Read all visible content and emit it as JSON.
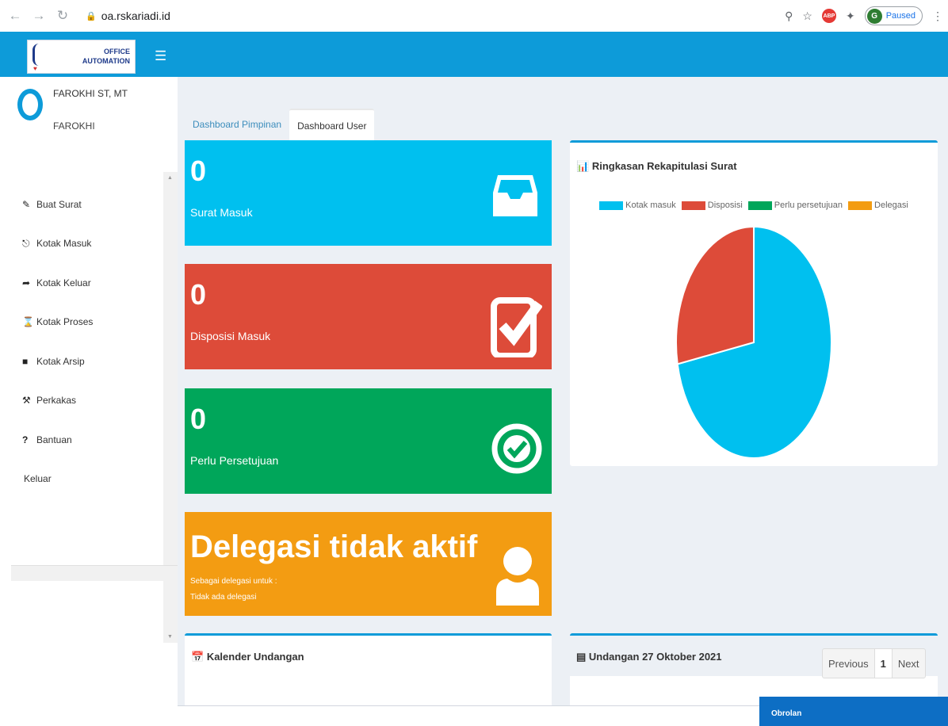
{
  "browser": {
    "url": "oa.rskariadi.id",
    "profile_initial": "G",
    "profile_status": "Paused",
    "ext_abp": "ABP"
  },
  "header": {
    "logo_line1": "OFFICE",
    "logo_line2": "AUTOMATION"
  },
  "user": {
    "name": "FAROKHI ST, MT",
    "subtitle": "FAROKHI"
  },
  "sidebar": {
    "items": [
      {
        "label": "Buat Surat",
        "icon": "edit-icon"
      },
      {
        "label": "Kotak Masuk",
        "icon": "inbox-icon"
      },
      {
        "label": "Kotak Keluar",
        "icon": "share-icon"
      },
      {
        "label": "Kotak Proses",
        "icon": "hourglass-icon"
      },
      {
        "label": "Kotak Arsip",
        "icon": "archive-icon"
      },
      {
        "label": "Perkakas",
        "icon": "wrench-icon"
      },
      {
        "label": "Bantuan",
        "icon": "question-icon"
      },
      {
        "label": "Keluar",
        "icon": ""
      }
    ]
  },
  "tabs": [
    {
      "label": "Dashboard Pimpinan",
      "active": false
    },
    {
      "label": "Dashboard User",
      "active": true
    }
  ],
  "cards": {
    "surat_masuk": {
      "value": "0",
      "label": "Surat Masuk",
      "color": "#00c0ef"
    },
    "disposisi": {
      "value": "0",
      "label": "Disposisi Masuk",
      "color": "#dd4b39"
    },
    "persetujuan": {
      "value": "0",
      "label": "Perlu Persetujuan",
      "color": "#00a65a"
    },
    "delegasi": {
      "title": "Delegasi tidak aktif",
      "line1": "Sebagai delegasi untuk :",
      "line2": "Tidak ada delegasi",
      "color": "#f39c12"
    }
  },
  "chart_panel": {
    "title": "Ringkasan Rekapitulasi Surat"
  },
  "chart_data": {
    "type": "pie",
    "title": "Ringkasan Rekapitulasi Surat",
    "categories": [
      "Kotak masuk",
      "Disposisi",
      "Perlu persetujuan",
      "Delegasi"
    ],
    "values": [
      72,
      28,
      0,
      0
    ],
    "colors": [
      "#00c0ef",
      "#dd4b39",
      "#00a65a",
      "#f39c12"
    ],
    "legend": "top"
  },
  "kalender": {
    "title": "Kalender Undangan"
  },
  "undangan": {
    "title": "Undangan 27 Oktober 2021",
    "pager": {
      "prev": "Previous",
      "page": "1",
      "next": "Next"
    }
  },
  "chat": {
    "label": "Obrolan"
  }
}
